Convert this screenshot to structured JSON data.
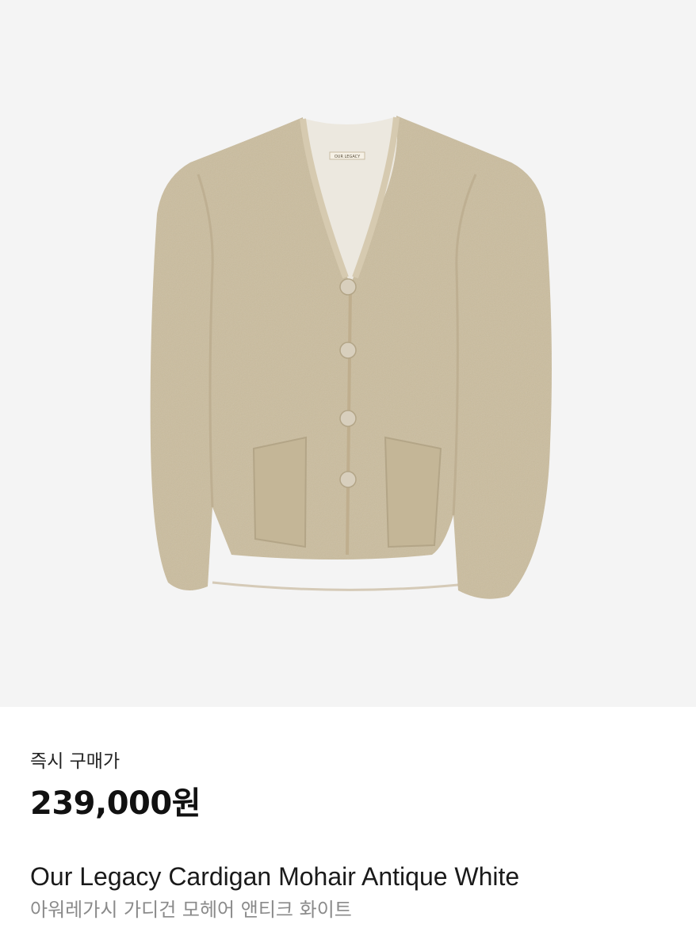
{
  "product": {
    "image_alt": "Mohair cardigan product photo",
    "brand_tag": "OUR LEGACY",
    "label_instant_price": "즉시 구매가",
    "price": "239,000원",
    "name_en": "Our Legacy Cardigan Mohair Antique White",
    "name_ko": "아워레가시 가디건 모헤어 앤티크 화이트"
  },
  "colors": {
    "image_background": "#f4f4f4",
    "garment": "#cbbd9f",
    "garment_shadow": "#b9aa8b",
    "lining": "#ece8df",
    "button": "#d8cfbd"
  }
}
